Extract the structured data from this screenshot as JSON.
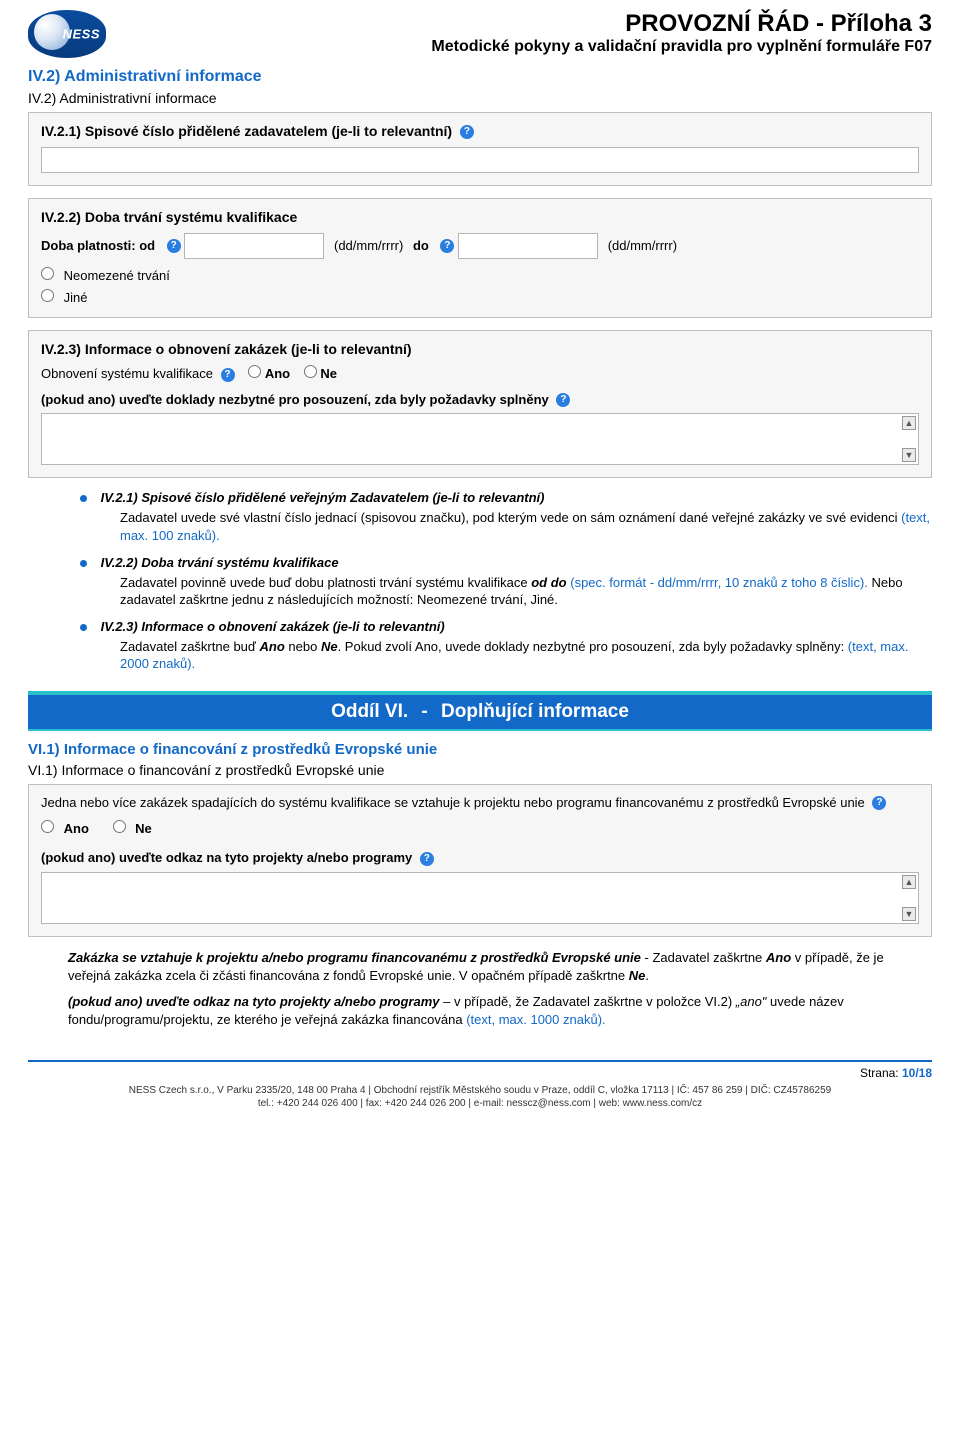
{
  "header": {
    "logo_text": "NESS",
    "title": "PROVOZNÍ ŘÁD - Příloha 3",
    "subtitle": "Metodické pokyny a validační pravidla pro vyplnění formuláře F07"
  },
  "section_iv2": {
    "heading_link": "IV.2) Administrativní informace",
    "label": "IV.2) Administrativní informace",
    "panel1_title": "IV.2.1) Spisové číslo přidělené zadavatelem (je-li to relevantní)",
    "panel2_title": "IV.2.2) Doba trvání systému kvalifikace",
    "duration_label": "Doba platnosti: od",
    "date_hint_1": "(dd/mm/rrrr)",
    "to_label": "do",
    "date_hint_2": "(dd/mm/rrrr)",
    "radio_unlimited": "Neomezené trvání",
    "radio_other": "Jiné",
    "panel3_title": "IV.2.3) Informace o obnovení zakázek (je-li to relevantní)",
    "renewal_label": "Obnovení systému kvalifikace",
    "radio_yes": "Ano",
    "radio_no": "Ne",
    "docs_hint": "(pokud ano) uveďte doklady nezbytné pro posouzení, zda byly požadavky splněny"
  },
  "bullets_iv2": {
    "b1_title": "IV.2.1) Spisové číslo přidělené veřejným Zadavatelem (je-li to relevantní)",
    "b1_text_a": "Zadavatel uvede své vlastní číslo jednací (spisovou značku), pod kterým vede on sám oznámení dané veřejné zakázky ve své evidenci ",
    "b1_text_b": "(text, max. 100 znaků).",
    "b2_title": "IV.2.2) Doba trvání systému kvalifikace",
    "b2_text_a": "Zadavatel povinně uvede buď dobu platnosti trvání systému kvalifikace ",
    "b2_text_b": "od do",
    "b2_text_c": " (spec. formát - dd/mm/rrrr, 10 znaků z toho 8 číslic).",
    "b2_text_d": " Nebo zadavatel zaškrtne jednu z následujících možností: Neomezené trvání, Jiné.",
    "b3_title": "IV.2.3) Informace o obnovení zakázek (je-li to relevantní)",
    "b3_text_a": "Zadavatel zaškrtne buď ",
    "b3_text_b": "Ano",
    "b3_text_c": " nebo ",
    "b3_text_d": "Ne",
    "b3_text_e": ". Pokud zvolí Ano, uvede doklady nezbytné pro posouzení, zda byly požadavky splněny: ",
    "b3_text_f": "(text, max. 2000 znaků)."
  },
  "banner": {
    "left": "Oddíl VI. ",
    "dash": "-",
    "right": " Doplňující informace"
  },
  "section_vi1": {
    "heading_link": "VI.1) Informace o  financování z  prostředků Evropské unie",
    "label": "VI.1) Informace o financování z prostředků Evropské unie",
    "question": "Jedna nebo více zakázek spadajících do systému kvalifikace se vztahuje k projektu nebo programu financovanému z prostředků Evropské unie",
    "radio_yes": "Ano",
    "radio_no": "Ne",
    "links_hint": "(pokud ano) uveďte odkaz na tyto projekty a/nebo programy"
  },
  "body_vi1": {
    "p1_lead": "Zakázka se vztahuje k projektu a/nebo programu financovanému z  prostředků Evropské unie",
    "p1_rest_a": " - Zadavatel zaškrtne ",
    "p1_rest_b": "Ano",
    "p1_rest_c": " v případě, že je veřejná zakázka zcela či zčásti financována z fondů Evropské unie. V opačném případě zaškrtne ",
    "p1_rest_d": "Ne",
    "p1_rest_e": ".",
    "p2_lead": "(pokud ano) uveďte odkaz na tyto projekty a/nebo programy",
    "p2_rest_a": " – v případě, že Zadavatel zaškrtne v položce VI.2) ",
    "p2_rest_b": "„ano\"",
    "p2_rest_c": " uvede název fondu/programu/projektu, ze kterého je veřejná zakázka financována ",
    "p2_rest_d": "(text, max. 1000 znaků)."
  },
  "footer": {
    "page_label": "Strana: ",
    "page_value": "10/18",
    "line1": "NESS Czech s.r.o., V Parku 2335/20, 148 00 Praha 4 | Obchodní rejstřík Městského soudu v Praze, oddíl C, vložka 17113 | IČ: 457 86 259 | DIČ: CZ45786259",
    "line2": "tel.: +420 244 026 400 | fax: +420 244 026 200 | e-mail: nesscz@ness.com | web: www.ness.com/cz"
  }
}
